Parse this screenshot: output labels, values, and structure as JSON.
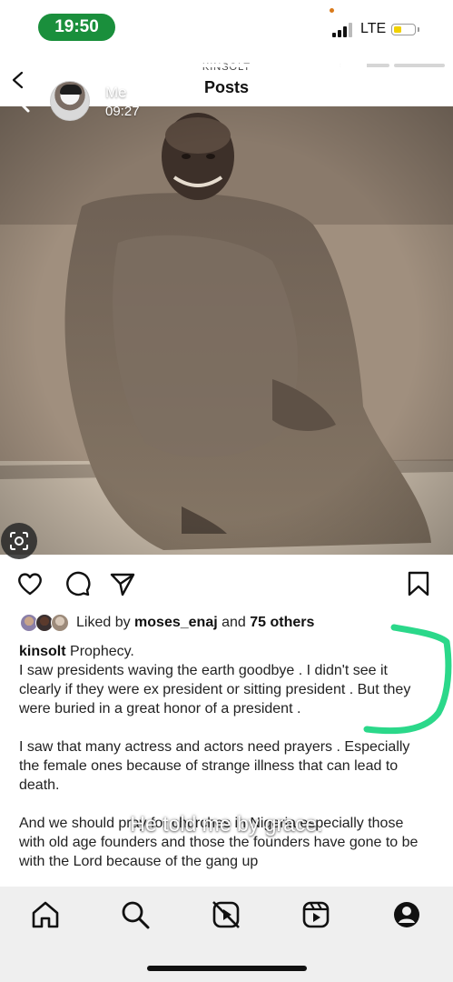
{
  "status_bar": {
    "time": "19:50",
    "network": "LTE",
    "battery_level": 0.4,
    "accent_color": "#1a8f3c"
  },
  "story": {
    "progress": [
      1,
      1,
      1,
      1,
      1,
      1,
      0.55,
      0
    ],
    "user_name": "Me",
    "timestamp": "09:27",
    "overlay_caption": "He told me by grace."
  },
  "instagram_header": {
    "username": "KINSOLT",
    "title": "Posts"
  },
  "post": {
    "likes": {
      "prefix": "Liked by",
      "user": "moses_enaj",
      "conjunction": "and",
      "others": "75 others"
    },
    "caption": {
      "username": "kinsolt",
      "paragraphs": [
        "Prophecy.\nI saw presidents waving the earth goodbye .  I didn't see it clearly if they were ex president or sitting president .  But they were buried in a great honor of a president .",
        "I saw that many actress and actors need prayers . Especially the female ones because of strange illness that can lead to death.",
        "And we should pray for churches in Nigeria especially those with old age founders and those the founders have gone to be with the Lord because of the gang up"
      ]
    }
  },
  "icons": {
    "back": "chevron-left-icon",
    "like": "heart-icon",
    "comment": "comment-icon",
    "share": "send-icon",
    "save": "bookmark-icon",
    "scan": "visual-search-icon"
  },
  "tabbar": {
    "items": [
      "home-icon",
      "search-icon",
      "reels-create-icon",
      "reels-icon",
      "profile-icon"
    ]
  },
  "annotation_color": "#2bd88a"
}
